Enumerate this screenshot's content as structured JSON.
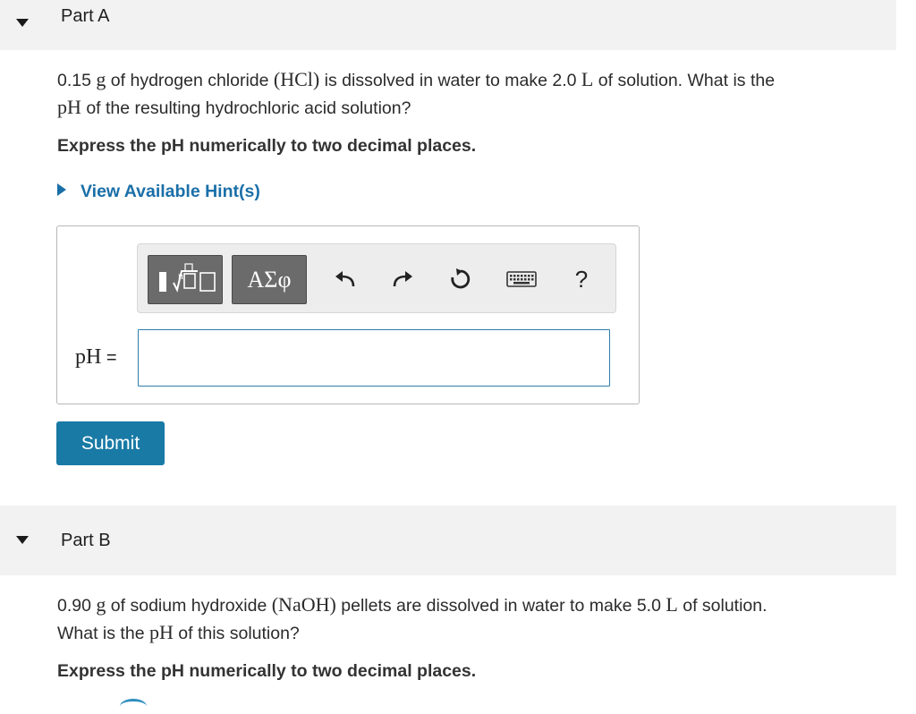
{
  "partA": {
    "title": "Part A",
    "question": {
      "t1": "0.15",
      "m1": "g",
      "t2": "of hydrogen chloride",
      "m2": "(HCl)",
      "t3": "is dissolved in water to make 2.0",
      "m3": "L",
      "t4": "of solution. What is the",
      "m4": "pH",
      "t5": "of the resulting hydrochloric acid solution?"
    },
    "instruction": "Express the pH numerically to two decimal places.",
    "hint": "View Available Hint(s)",
    "toolbar": {
      "greek_label": "ΑΣφ",
      "help_label": "?"
    },
    "answer": {
      "label_math": "pH",
      "label_eq": "=",
      "value": ""
    },
    "submit_label": "Submit"
  },
  "partB": {
    "title": "Part B",
    "question": {
      "t1": "0.90",
      "m1": "g",
      "t2": "of sodium hydroxide",
      "m2": "(NaOH)",
      "t3": "pellets are dissolved in water to make 5.0",
      "m3": "L",
      "t4": "of solution.",
      "t5": "What is the",
      "m4": "pH",
      "t6": "of this solution?"
    },
    "instruction": "Express the pH numerically to two decimal places."
  }
}
